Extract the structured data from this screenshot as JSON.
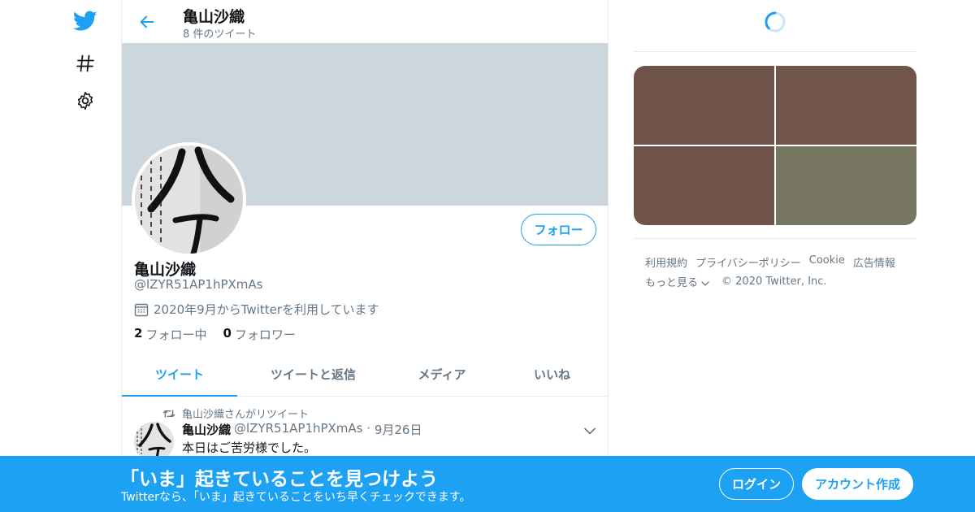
{
  "colors": {
    "accent": "#1da1f2",
    "banner": "#ccd6dd",
    "secondary_text": "#657786",
    "media": [
      "#6f5349",
      "#725549",
      "#6f5349",
      "#777660"
    ]
  },
  "nav": {
    "icons": [
      "twitter-bird-icon",
      "hashtag-icon",
      "gear-icon"
    ]
  },
  "header": {
    "name": "亀山沙織",
    "tweet_count": "8 件のツイート"
  },
  "profile": {
    "follow_label": "フォロー",
    "name": "亀山沙織",
    "handle": "@lZYR51AP1hPXmAs",
    "joined": "2020年9月からTwitterを利用しています",
    "following_count": "2",
    "following_label": "フォロー中",
    "followers_count": "0",
    "followers_label": "フォロワー"
  },
  "tabs": [
    {
      "label": "ツイート",
      "active": true
    },
    {
      "label": "ツイートと返信",
      "active": false
    },
    {
      "label": "メディア",
      "active": false
    },
    {
      "label": "いいね",
      "active": false
    }
  ],
  "tweet": {
    "retweet_line": "亀山沙織さんがリツイート",
    "author_name": "亀山沙織",
    "author_handle": "@lZYR51AP1hPXmAs",
    "date": "9月26日",
    "text": "本日はご苦労様でした。"
  },
  "footer": {
    "links": [
      "利用規約",
      "プライバシーポリシー",
      "Cookie",
      "広告情報"
    ],
    "more": "もっと見る",
    "copyright": "© 2020 Twitter, Inc."
  },
  "bottom_bar": {
    "title": "「いま」起きていることを見つけよう",
    "subtitle": "Twitterなら、「いま」起きていることをいち早くチェックできます。",
    "login_label": "ログイン",
    "signup_label": "アカウント作成"
  }
}
